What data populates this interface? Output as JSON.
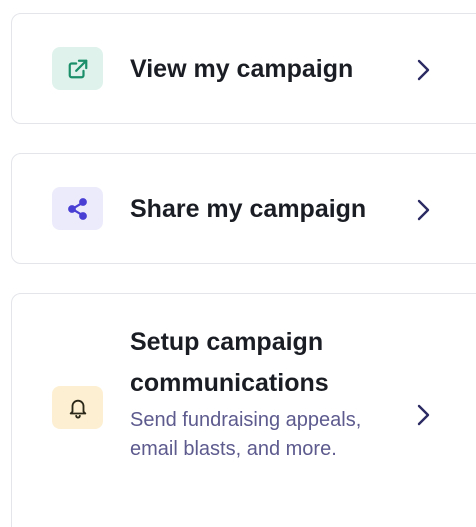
{
  "cards": [
    {
      "title": "View my campaign",
      "icon": "external-link-icon",
      "icon_bg": "#dff3ec",
      "icon_color": "#1b8f6a"
    },
    {
      "title": "Share my campaign",
      "icon": "share-icon",
      "icon_bg": "#ecebfb",
      "icon_color": "#4a3fd4"
    },
    {
      "title": "Setup campaign communications",
      "subtitle": "Send fundraising appeals, email blasts, and more.",
      "icon": "bell-icon",
      "icon_bg": "#fdf0d2",
      "icon_color": "#2a2618"
    }
  ],
  "colors": {
    "title": "#1b1d24",
    "subtitle": "#5d5a8e",
    "chevron": "#2b2a63",
    "border": "#e3e5ea"
  }
}
